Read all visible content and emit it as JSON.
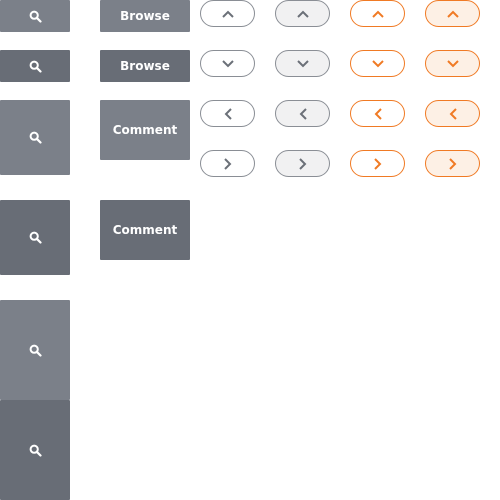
{
  "buttons": {
    "browse_label": "Browse",
    "comment_label": "Comment"
  },
  "colors": {
    "button_gray_light": "#7b8089",
    "button_gray_dark": "#686d76",
    "outline_gray": "#8a8e95",
    "accent_orange": "#f07a24"
  },
  "icons": {
    "search": "search-icon",
    "up": "chevron-up-icon",
    "down": "chevron-down-icon",
    "left": "chevron-left-icon",
    "right": "chevron-right-icon"
  }
}
